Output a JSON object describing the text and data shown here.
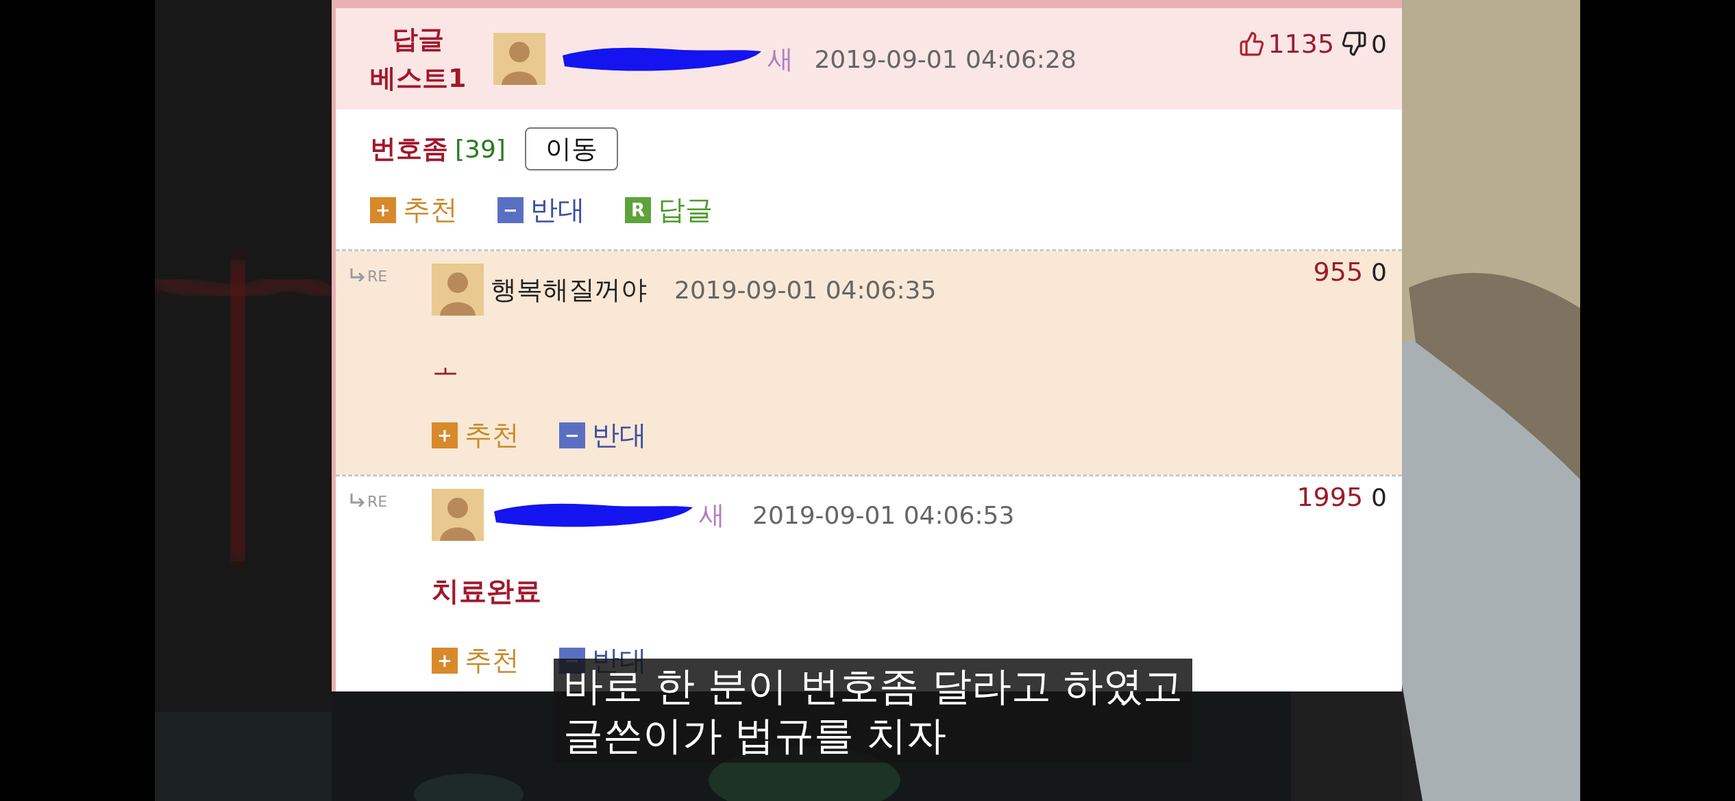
{
  "post": {
    "badge_lines": [
      "답글",
      "베스트1"
    ],
    "author": {
      "redacted": true,
      "name": "새"
    },
    "date": "2019-09-01 04:06:28",
    "likes": "1135",
    "dislikes": "0",
    "body": "번호좀",
    "count": "[39]",
    "move_button": "이동",
    "actions": [
      {
        "kind": "recommend",
        "mark": "+",
        "label": "추천"
      },
      {
        "kind": "oppose",
        "mark": "−",
        "label": "반대"
      },
      {
        "kind": "reply",
        "mark": "R",
        "label": "답글"
      }
    ]
  },
  "replies": [
    {
      "re_label": "RE",
      "highlighted": true,
      "author": {
        "redacted": false,
        "name": "행복해질꺼야"
      },
      "date": "2019-09-01 04:06:35",
      "likes": "955",
      "dislikes": "0",
      "body": "ㅗ",
      "bold": false,
      "actions": [
        {
          "kind": "recommend",
          "mark": "+",
          "label": "추천"
        },
        {
          "kind": "oppose",
          "mark": "−",
          "label": "반대"
        }
      ]
    },
    {
      "re_label": "RE",
      "highlighted": false,
      "author": {
        "redacted": true,
        "name": "새"
      },
      "date": "2019-09-01 04:06:53",
      "likes": "1995",
      "dislikes": "0",
      "body": "치료완료",
      "bold": true,
      "actions": [
        {
          "kind": "recommend",
          "mark": "+",
          "label": "추천"
        },
        {
          "kind": "oppose",
          "mark": "−",
          "label": "반대"
        }
      ]
    }
  ],
  "subtitle": [
    "바로 한 분이 번호좀 달라고 하였고",
    "글쓴이가 법규를 치자"
  ]
}
